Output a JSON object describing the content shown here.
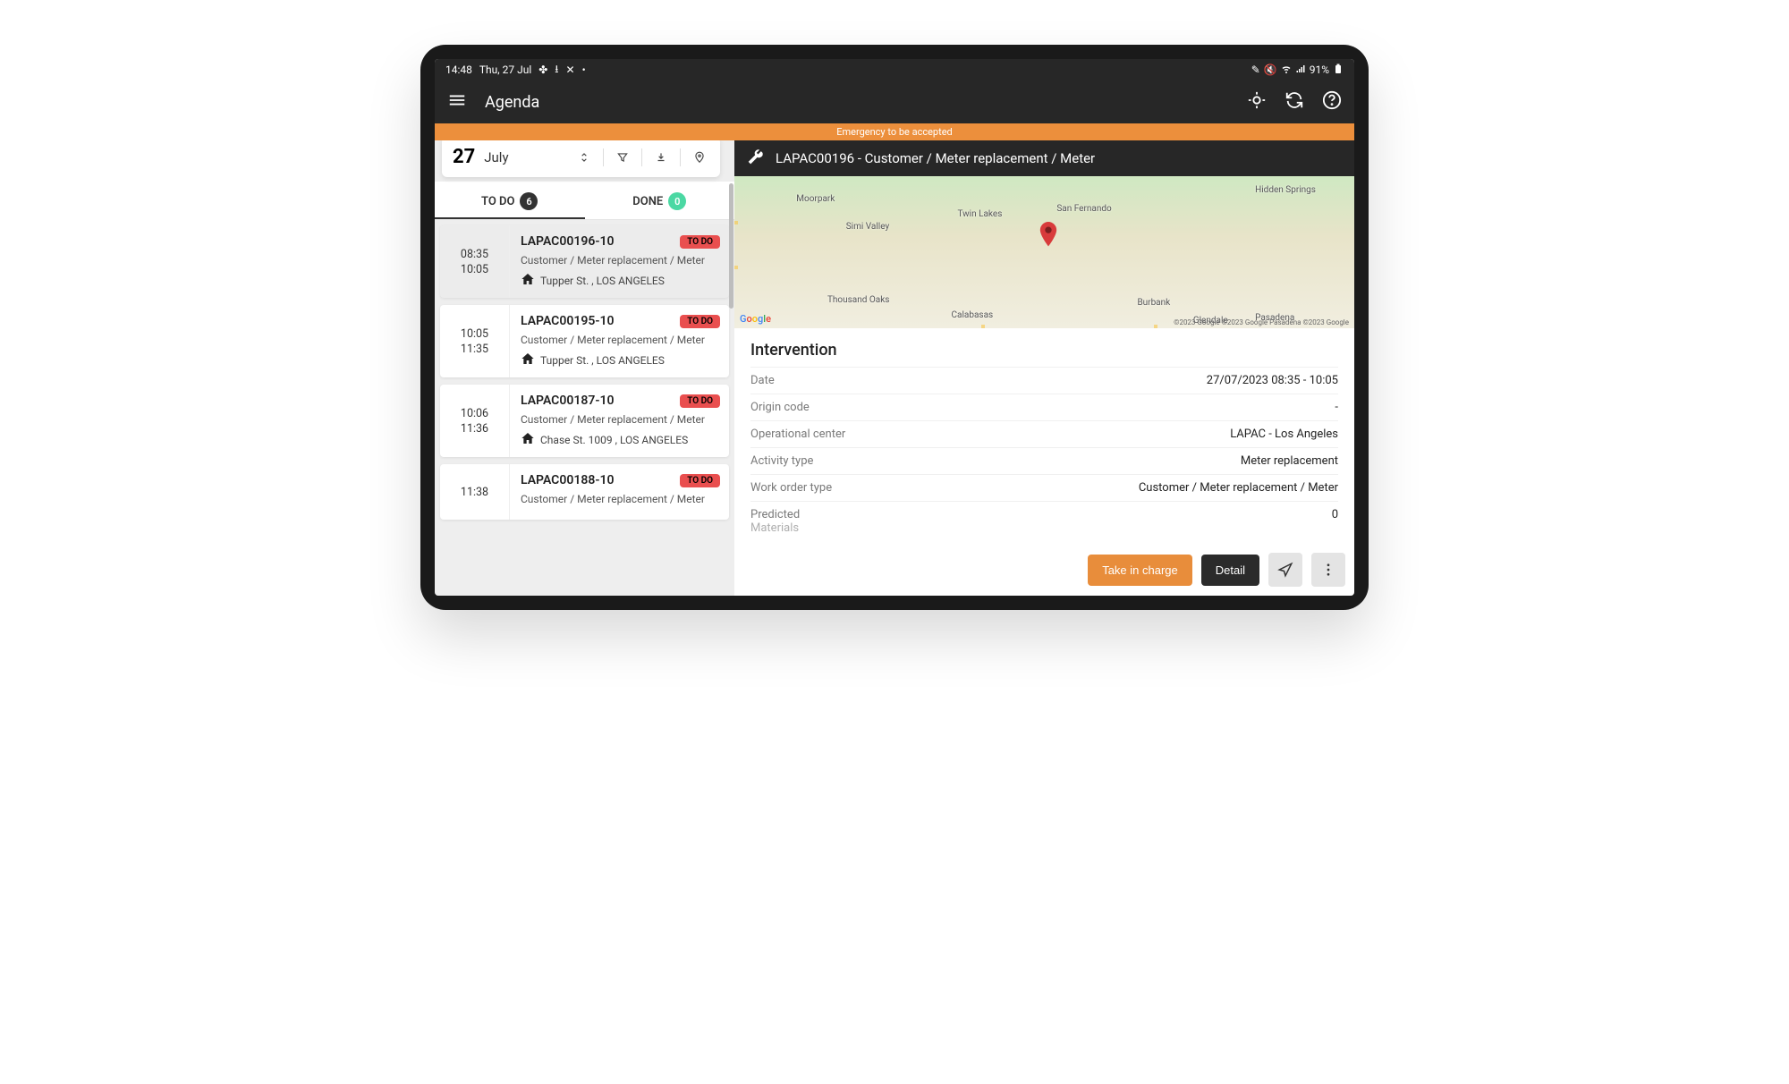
{
  "status": {
    "time": "14:48",
    "date": "Thu, 27 Jul",
    "battery": "91%"
  },
  "app": {
    "title": "Agenda"
  },
  "banner": "Emergency to be accepted",
  "date_picker": {
    "day": "27",
    "month": "July"
  },
  "tabs": {
    "todo_label": "TO DO",
    "todo_count": "6",
    "done_label": "DONE",
    "done_count": "0"
  },
  "items": [
    {
      "start": "08:35",
      "end": "10:05",
      "id": "LAPAC00196-10",
      "status": "TO DO",
      "desc": "Customer / Meter replacement / Meter",
      "addr": "Tupper St. , LOS ANGELES",
      "selected": true
    },
    {
      "start": "10:05",
      "end": "11:35",
      "id": "LAPAC00195-10",
      "status": "TO DO",
      "desc": "Customer / Meter replacement / Meter",
      "addr": "Tupper St. , LOS ANGELES",
      "selected": false
    },
    {
      "start": "10:06",
      "end": "11:36",
      "id": "LAPAC00187-10",
      "status": "TO DO",
      "desc": "Customer / Meter replacement / Meter",
      "addr": "Chase St. 1009 , LOS ANGELES",
      "selected": false
    },
    {
      "start": "11:38",
      "end": "",
      "id": "LAPAC00188-10",
      "status": "TO DO",
      "desc": "Customer / Meter replacement / Meter",
      "addr": "",
      "selected": false
    }
  ],
  "header": {
    "title": "LAPAC00196 - Customer / Meter replacement / Meter"
  },
  "map": {
    "labels": {
      "moorpark": "Moorpark",
      "simi": "Simi Valley",
      "twin": "Twin Lakes",
      "sanf": "San Fernando",
      "hidden": "Hidden Springs",
      "thousand": "Thousand Oaks",
      "calabasas": "Calabasas",
      "burbank": "Burbank",
      "glendale": "Glendale",
      "pasadena": "Pasadena"
    },
    "google": "Google",
    "copy": "©2023 Google  ©2023 Google  Pasadena  ©2023 Google"
  },
  "intervention": {
    "title": "Intervention",
    "rows": {
      "date_label": "Date",
      "date_val": "27/07/2023 08:35 - 10:05",
      "origin_label": "Origin code",
      "origin_val": "-",
      "oc_label": "Operational center",
      "oc_val": "LAPAC - Los Angeles",
      "act_label": "Activity type",
      "act_val": "Meter replacement",
      "wo_label": "Work order type",
      "wo_val": "Customer / Meter replacement / Meter",
      "pred_label": "Predicted",
      "pred_val": "0",
      "mat_label": "Materials"
    }
  },
  "actions": {
    "take": "Take in charge",
    "detail": "Detail"
  }
}
